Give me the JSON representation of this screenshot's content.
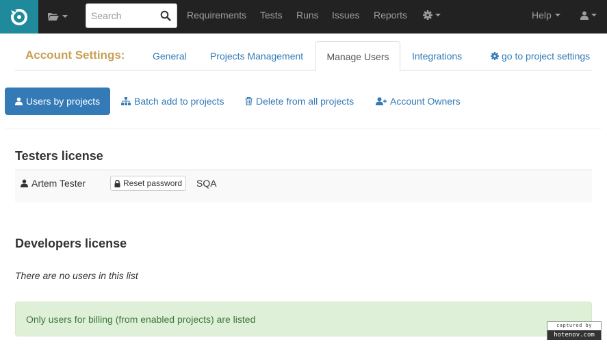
{
  "navbar": {
    "search": {
      "placeholder": "Search"
    },
    "links": [
      "Requirements",
      "Tests",
      "Runs",
      "Issues",
      "Reports"
    ],
    "help_label": "Help",
    "bg_color": "#222222",
    "logo_bg": "#1f8a9b"
  },
  "settings": {
    "title": "Account Settings:",
    "tabs": [
      {
        "label": "General",
        "active": false
      },
      {
        "label": "Projects Management",
        "active": false
      },
      {
        "label": "Manage Users",
        "active": true
      },
      {
        "label": "Integrations",
        "active": false
      }
    ],
    "project_settings_label": "go to project settings"
  },
  "subnav": {
    "items": [
      {
        "label": "Users by projects",
        "icon": "user-icon",
        "active": true
      },
      {
        "label": "Batch add to projects",
        "icon": "sitemap-icon",
        "active": false
      },
      {
        "label": "Delete from all projects",
        "icon": "trash-icon",
        "active": false
      },
      {
        "label": "Account Owners",
        "icon": "user-plus-icon",
        "active": false
      }
    ]
  },
  "testers": {
    "heading": "Testers license",
    "users": [
      {
        "name": "Artem Tester",
        "reset_label": "Reset password",
        "project": "SQA"
      }
    ]
  },
  "developers": {
    "heading": "Developers license",
    "empty_message": "There are no users in this list"
  },
  "alert": {
    "message": "Only users for billing (from enabled projects) are listed",
    "color": "#dff0d8"
  },
  "watermark": {
    "top": "captured by",
    "bottom": "hotenov.com"
  }
}
